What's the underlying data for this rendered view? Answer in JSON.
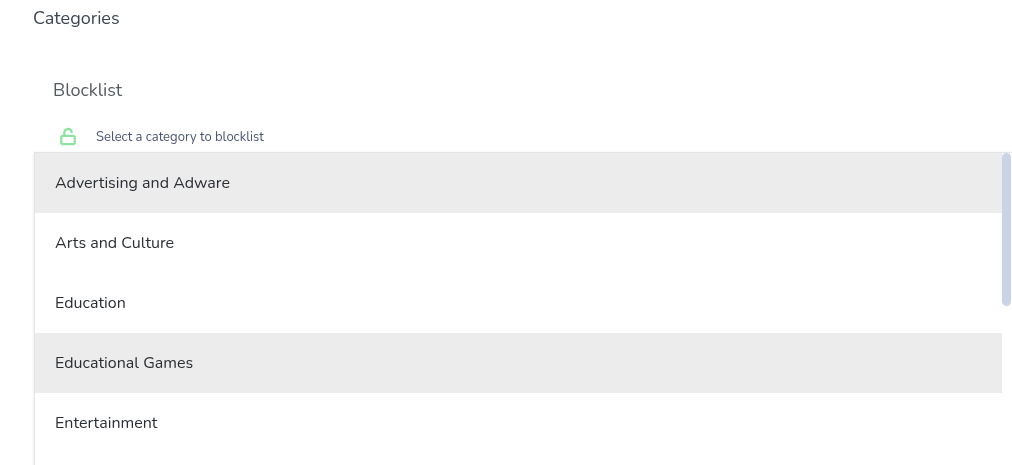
{
  "title": "Categories",
  "section": {
    "title": "Blocklist",
    "hint": "Select a category to blocklist"
  },
  "options": [
    {
      "label": "Advertising and Adware",
      "selected": true
    },
    {
      "label": "Arts and Culture",
      "selected": false
    },
    {
      "label": "Education",
      "selected": false
    },
    {
      "label": "Educational Games",
      "selected": true
    },
    {
      "label": "Entertainment",
      "selected": false
    }
  ]
}
